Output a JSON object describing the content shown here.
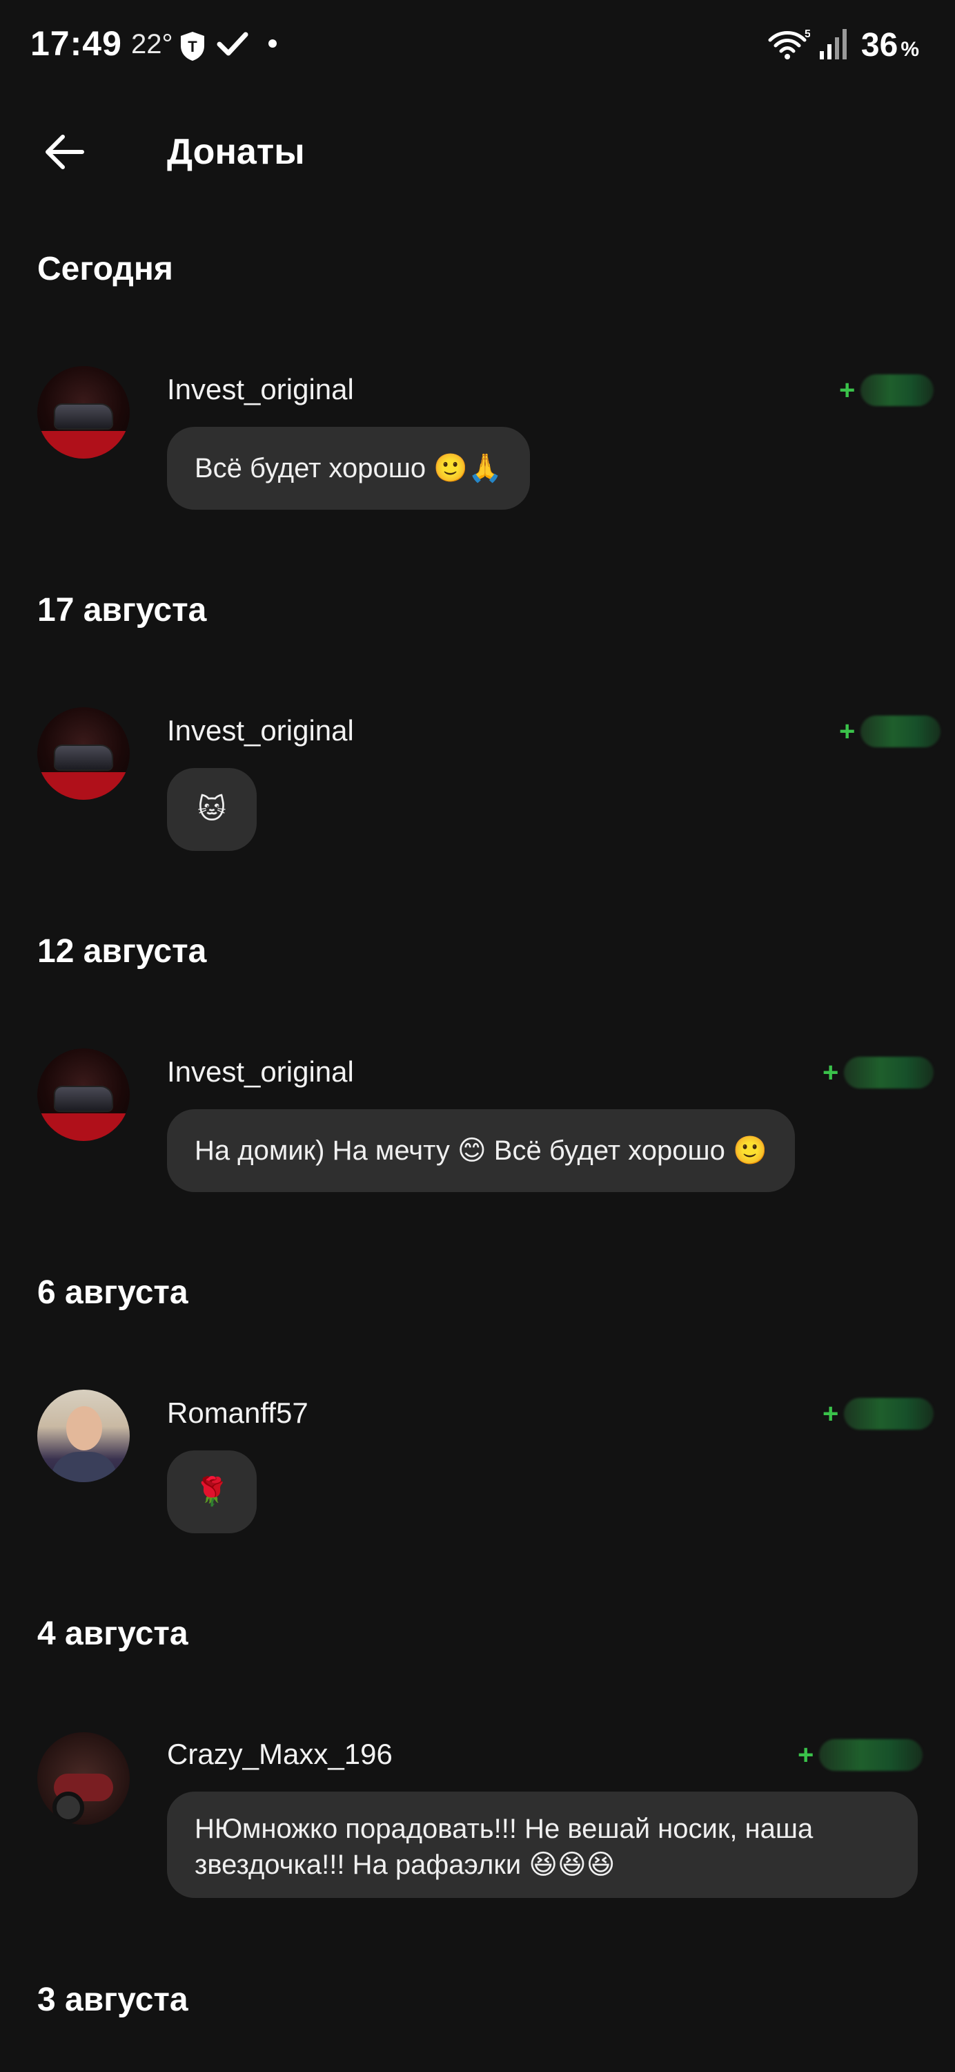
{
  "status_bar": {
    "time": "17:49",
    "temperature": "22°",
    "battery_percent": "36",
    "battery_unit": "%",
    "wifi_badge": "5"
  },
  "header": {
    "title": "Донаты",
    "back_icon": "arrow-left-icon"
  },
  "sections": [
    {
      "date": "Сегодня",
      "donations": [
        {
          "user": "Invest_original",
          "avatar": "car-avatar",
          "amount_prefix": "+",
          "message": "Всё будет хорошо 🙂🙏"
        }
      ]
    },
    {
      "date": "17 августа",
      "donations": [
        {
          "user": "Invest_original",
          "avatar": "car-avatar",
          "amount_prefix": "+",
          "message": "🐱"
        }
      ]
    },
    {
      "date": "12 августа",
      "donations": [
        {
          "user": "Invest_original",
          "avatar": "car-avatar",
          "amount_prefix": "+",
          "message": "На домик) На мечту 😊 Всё будет хорошо 🙂"
        }
      ]
    },
    {
      "date": "6 августа",
      "donations": [
        {
          "user": "Romanff57",
          "avatar": "person-avatar",
          "amount_prefix": "+",
          "message": "🌹"
        }
      ]
    },
    {
      "date": "4 августа",
      "donations": [
        {
          "user": "Crazy_Maxx_196",
          "avatar": "motorcycle-avatar",
          "amount_prefix": "+",
          "message": "НЮмножко порадовать!!! Не вешай носик, наша звездочка!!! На рафаэлки 😆😆😆"
        }
      ]
    },
    {
      "date": "3 августа",
      "donations": []
    }
  ]
}
